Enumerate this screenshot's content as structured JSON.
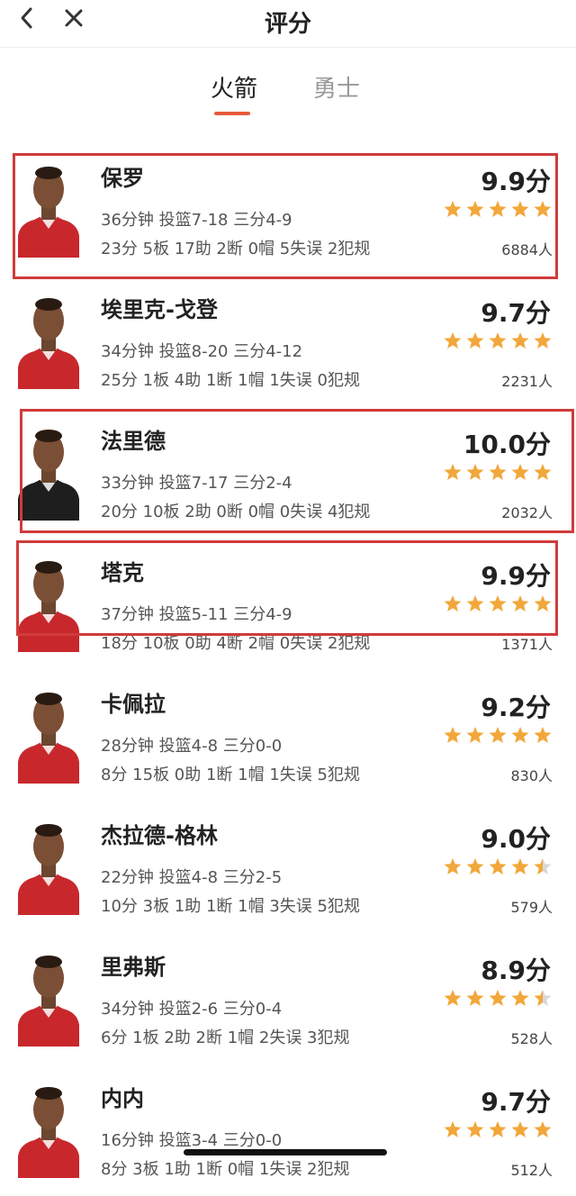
{
  "header": {
    "title": "评分",
    "back_icon": "chevron-left-icon",
    "close_icon": "close-icon"
  },
  "tabs": [
    {
      "label": "火箭",
      "active": true
    },
    {
      "label": "勇士",
      "active": false
    }
  ],
  "colors": {
    "accent": "#e85a3c",
    "star": "#f2a73b",
    "highlight": "#d13b3b",
    "jersey_red": "#c8282c",
    "jersey_black": "#1e1e1e"
  },
  "players": [
    {
      "name": "保罗",
      "line1": "36分钟 投篮7-18 三分4-9",
      "line2": "23分 5板 17助 2断 0帽 5失误 2犯规",
      "score": "9.9分",
      "stars": 5,
      "votes": "6884人",
      "jersey": "red",
      "highlighted": true
    },
    {
      "name": "埃里克-戈登",
      "line1": "34分钟 投篮8-20 三分4-12",
      "line2": "25分 1板 4助 1断 1帽 1失误 0犯规",
      "score": "9.7分",
      "stars": 5,
      "votes": "2231人",
      "jersey": "red",
      "highlighted": false
    },
    {
      "name": "法里德",
      "line1": "33分钟 投篮7-17 三分2-4",
      "line2": "20分 10板 2助 0断 0帽 0失误 4犯规",
      "score": "10.0分",
      "stars": 5,
      "votes": "2032人",
      "jersey": "black",
      "highlighted": true
    },
    {
      "name": "塔克",
      "line1": "37分钟 投篮5-11 三分4-9",
      "line2": "18分 10板 0助 4断 2帽 0失误 2犯规",
      "score": "9.9分",
      "stars": 5,
      "votes": "1371人",
      "jersey": "red",
      "highlighted": true
    },
    {
      "name": "卡佩拉",
      "line1": "28分钟 投篮4-8 三分0-0",
      "line2": "8分 15板 0助 1断 1帽 1失误 5犯规",
      "score": "9.2分",
      "stars": 5,
      "votes": "830人",
      "jersey": "red",
      "highlighted": false
    },
    {
      "name": "杰拉德-格林",
      "line1": "22分钟 投篮4-8 三分2-5",
      "line2": "10分 3板 1助 1断 1帽 3失误 5犯规",
      "score": "9.0分",
      "stars": 4.5,
      "votes": "579人",
      "jersey": "red",
      "highlighted": false
    },
    {
      "name": "里弗斯",
      "line1": "34分钟 投篮2-6 三分0-4",
      "line2": "6分 1板 2助 2断 1帽 2失误 3犯规",
      "score": "8.9分",
      "stars": 4.5,
      "votes": "528人",
      "jersey": "red",
      "highlighted": false
    },
    {
      "name": "内内",
      "line1": "16分钟 投篮3-4 三分0-0",
      "line2": "8分 3板 1助 1断 0帽 1失误 2犯规",
      "score": "9.7分",
      "stars": 5,
      "votes": "512人",
      "jersey": "red",
      "highlighted": false
    }
  ]
}
